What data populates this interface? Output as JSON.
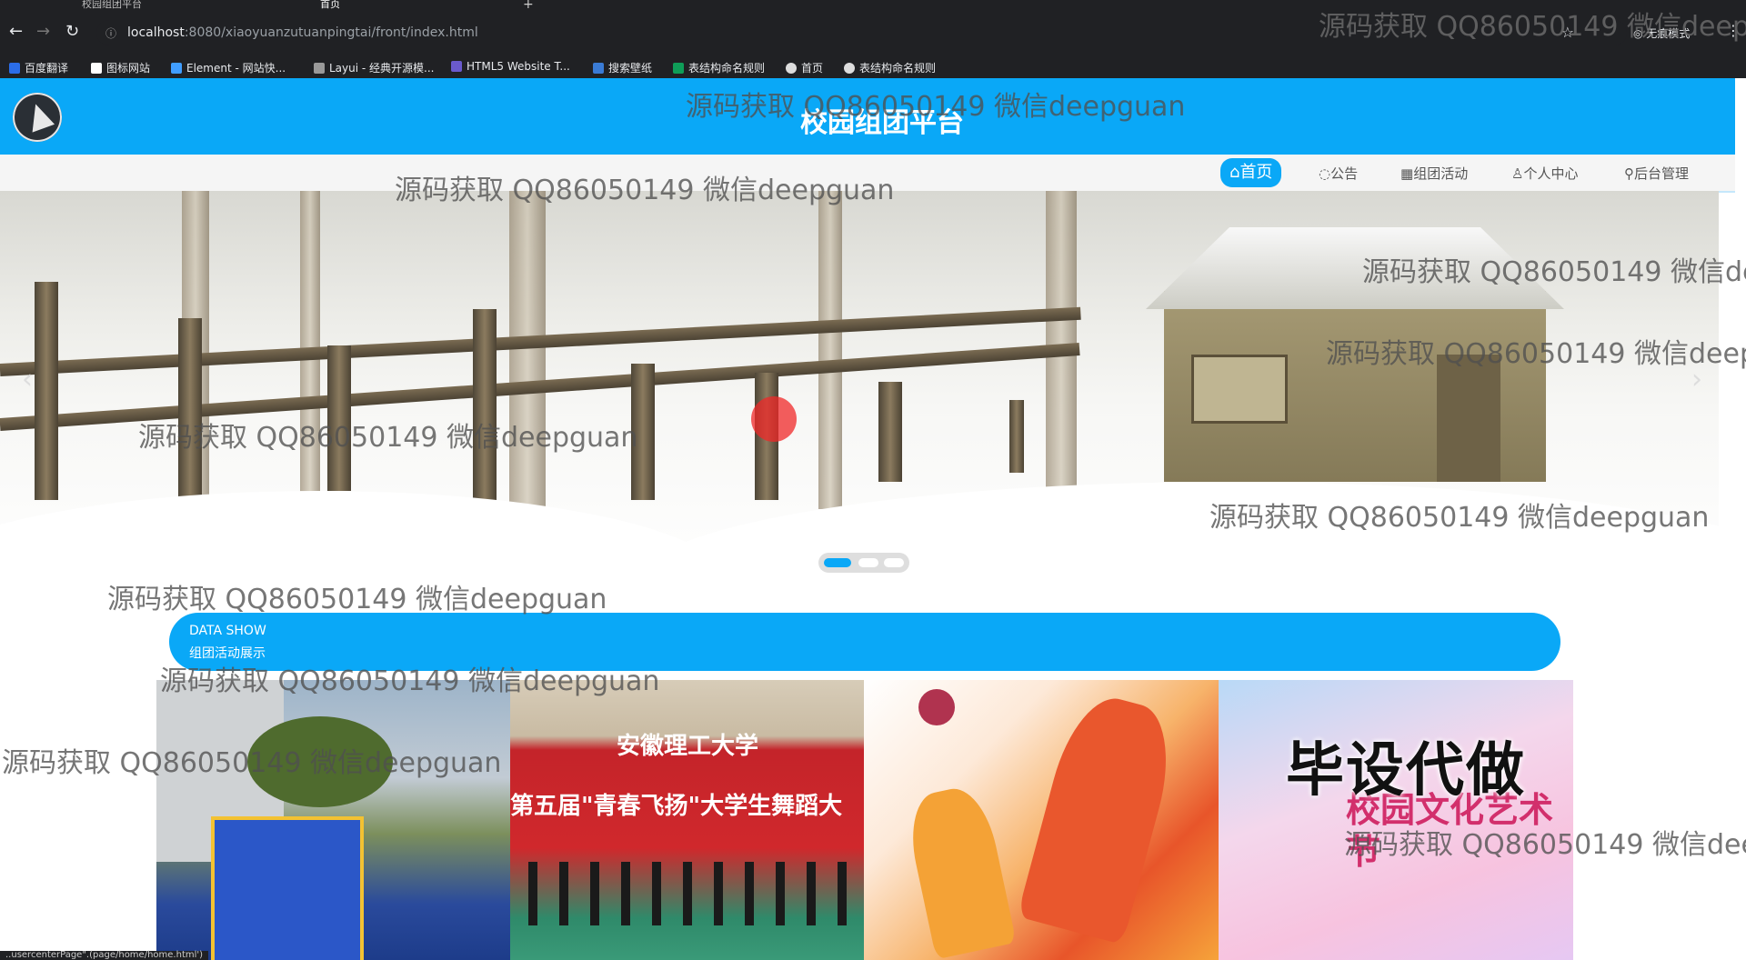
{
  "browser": {
    "tabs": [
      {
        "title": "校园组团平台",
        "active": false
      },
      {
        "title": "首页",
        "active": true
      }
    ],
    "url_host": "localhost",
    "url_path": ":8080/xiaoyuanzutuanpingtai/front/index.html",
    "profile_label": "无痕模式",
    "bookmarks": [
      {
        "label": "百度翻译",
        "color": "#2b6de8"
      },
      {
        "label": "图标网站",
        "color": "#ffffff"
      },
      {
        "label": "Element - 网站快...",
        "color": "#409eff"
      },
      {
        "label": "Layui - 经典开源模...",
        "color": "#999999"
      },
      {
        "label": "HTML5 Website T...",
        "color": "#6a5acd"
      },
      {
        "label": "搜索壁纸",
        "color": "#3a7bd5"
      },
      {
        "label": "表结构命名规则",
        "color": "#0f9d58"
      },
      {
        "label": "首页",
        "color": "#dddddd"
      },
      {
        "label": "表结构命名规则",
        "color": "#dddddd"
      }
    ],
    "status_url": "..usercenterPage\".(page/home/home.html')"
  },
  "header": {
    "title": "校园组团平台"
  },
  "nav": {
    "items": [
      {
        "label": "首页",
        "icon": "home-icon",
        "active": true
      },
      {
        "label": "公告",
        "icon": "notice-icon",
        "active": false
      },
      {
        "label": "组团活动",
        "icon": "activity-icon",
        "active": false
      },
      {
        "label": "个人中心",
        "icon": "user-icon",
        "active": false
      },
      {
        "label": "后台管理",
        "icon": "link-icon",
        "active": false
      }
    ]
  },
  "carousel": {
    "slide_count": 3,
    "active_index": 0,
    "prev_symbol": "‹",
    "next_symbol": "›"
  },
  "section": {
    "title_en": "DATA SHOW",
    "title_cn": "组团活动展示"
  },
  "cards": [
    {
      "name": "card-activity-1"
    },
    {
      "name": "card-activity-2",
      "banner_text": "安徽理工大学",
      "slogan": "第五届\"青春飞扬\"大学生舞蹈大"
    },
    {
      "name": "card-activity-3"
    },
    {
      "name": "card-activity-4",
      "overlay_text": "毕设代做",
      "sub_text": "校园文化艺术节"
    }
  ],
  "watermark_text": "源码获取 QQ86050149 微信deepguan"
}
